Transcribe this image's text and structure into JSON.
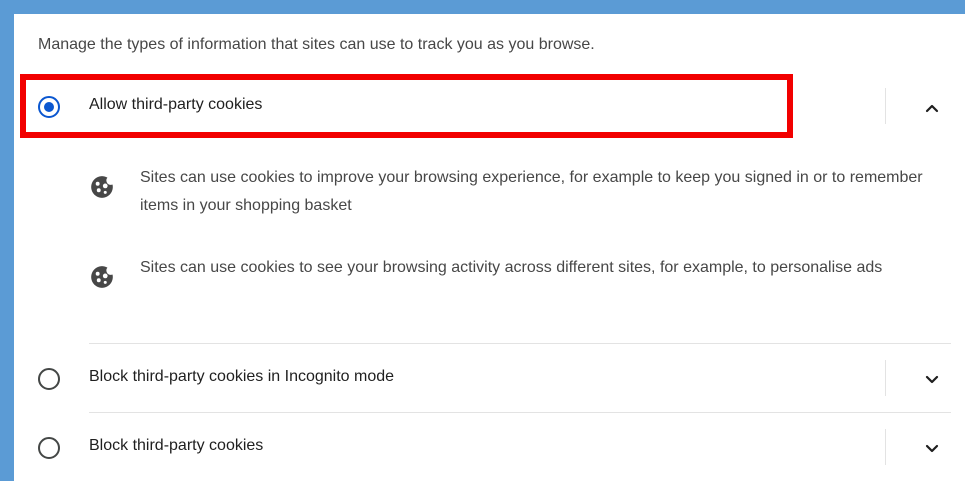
{
  "intro_text": "Manage the types of information that sites can use to track you as you browse.",
  "options": [
    {
      "label": "Allow third-party cookies",
      "selected": true,
      "expanded": true
    },
    {
      "label": "Block third-party cookies in Incognito mode",
      "selected": false,
      "expanded": false
    },
    {
      "label": "Block third-party cookies",
      "selected": false,
      "expanded": false
    }
  ],
  "allow_details": [
    {
      "icon": "cookie-icon",
      "text": "Sites can use cookies to improve your browsing experience, for example to keep you signed in or to remember items in your shopping basket"
    },
    {
      "icon": "cookie-icon",
      "text": "Sites can use cookies to see your browsing activity across different sites, for example, to personalise ads"
    }
  ],
  "colors": {
    "accent": "#0b57d0",
    "highlight": "#f20000",
    "frame": "#5b9bd5"
  }
}
